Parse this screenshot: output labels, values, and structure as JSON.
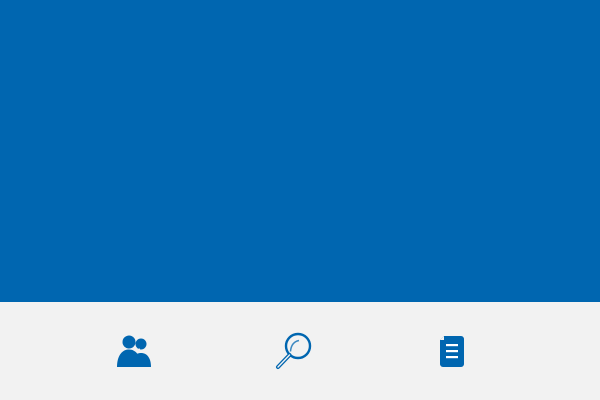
{
  "theme": {
    "primary": "#0066b0",
    "nav_background": "#f2f2f2"
  },
  "bottom_nav": {
    "items": [
      {
        "id": "contacts",
        "icon": "contacts-icon"
      },
      {
        "id": "search",
        "icon": "search-icon"
      },
      {
        "id": "documents",
        "icon": "document-icon"
      }
    ]
  }
}
